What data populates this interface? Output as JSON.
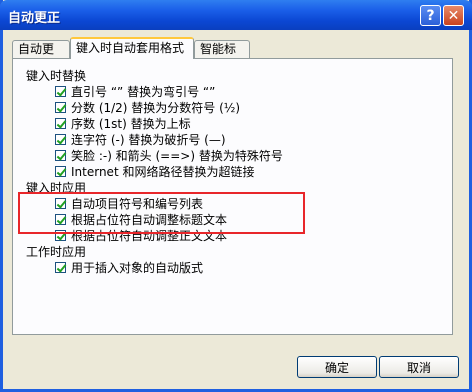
{
  "window": {
    "title": "自动更正"
  },
  "titlebar": {
    "help_label": "?",
    "close_label": "✕"
  },
  "tabs": [
    {
      "label": "自动更正"
    },
    {
      "label": "键入时自动套用格式",
      "selected": true
    },
    {
      "label": "智能标记"
    }
  ],
  "sections": [
    {
      "label": "键入时替换",
      "options": [
        {
          "label": "直引号 “” 替换为弯引号 “”",
          "checked": true
        },
        {
          "label": "分数 (1/2) 替换为分数符号 (½)",
          "checked": true
        },
        {
          "label": "序数 (1st) 替换为上标",
          "checked": true
        },
        {
          "label": "连字符 (-) 替换为破折号 (—)",
          "checked": true
        },
        {
          "label": "笑脸 :-) 和箭头 (==>) 替换为特殊符号",
          "checked": true
        },
        {
          "label": "Internet 和网络路径替换为超链接",
          "checked": true
        }
      ]
    },
    {
      "label": "键入时应用",
      "options": [
        {
          "label": "自动项目符号和编号列表",
          "checked": true
        },
        {
          "label": "根据占位符自动调整标题文本",
          "checked": true
        },
        {
          "label": "根据占位符自动调整正文文本",
          "checked": true
        }
      ]
    },
    {
      "label": "工作时应用",
      "options": [
        {
          "label": "用于插入对象的自动版式",
          "checked": true
        }
      ]
    }
  ],
  "buttons": {
    "ok": "确定",
    "cancel": "取消"
  },
  "colors": {
    "titlebar": "#0b47d3",
    "highlight": "#e8262a",
    "checkmark": "#21a121"
  }
}
